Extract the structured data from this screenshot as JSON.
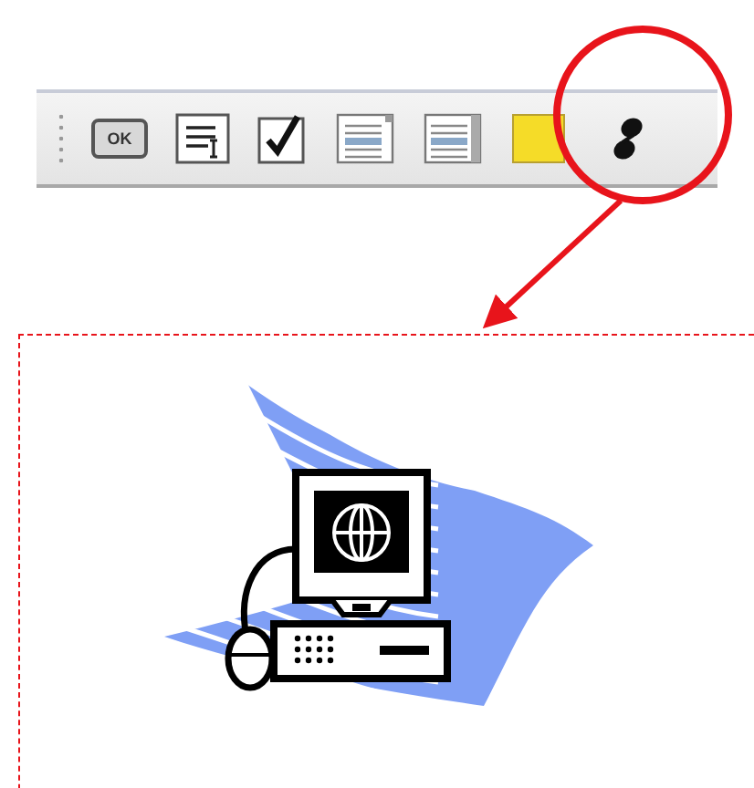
{
  "toolbar": {
    "items": [
      {
        "kind": "button",
        "label": "OK"
      },
      {
        "kind": "textfield"
      },
      {
        "kind": "checkbox"
      },
      {
        "kind": "listbox"
      },
      {
        "kind": "combolist"
      },
      {
        "kind": "panel"
      },
      {
        "kind": "link"
      }
    ]
  },
  "callout": {
    "kind": "computer"
  }
}
